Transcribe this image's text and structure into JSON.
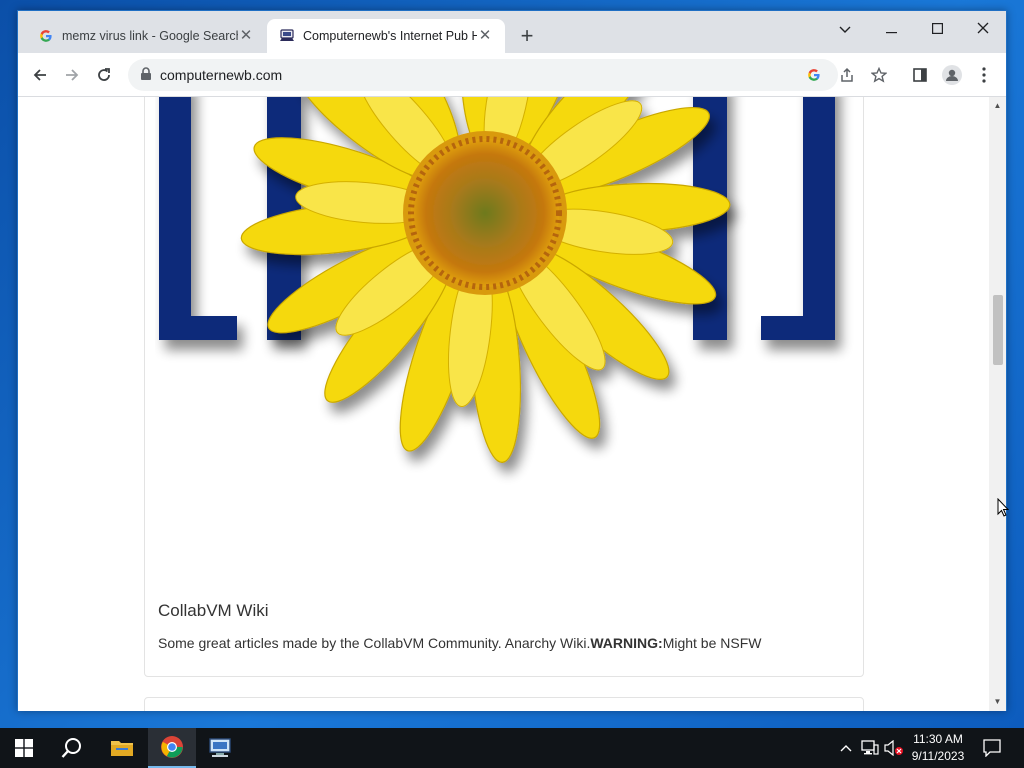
{
  "browser": {
    "tabs": [
      {
        "title": "memz virus link - Google Search",
        "active": false,
        "icon": "google-g-icon"
      },
      {
        "title": "Computernewb's Internet Pub Hub",
        "active": true,
        "icon": "computernewb-icon"
      }
    ],
    "new_tab_label": "+",
    "url": "computernewb.com"
  },
  "page": {
    "card": {
      "image_description_icon": "sunflower-logo",
      "title": "CollabVM Wiki",
      "text_prefix": "Some great articles made by the CollabVM Community. Anarchy Wiki.",
      "warning_label": "WARNING:",
      "text_suffix": "Might be NSFW"
    }
  },
  "taskbar": {
    "items": [
      "start-icon",
      "search-icon",
      "file-explorer-icon",
      "chrome-icon",
      "network-app-icon"
    ],
    "clock_time": "11:30 AM",
    "clock_date": "9/11/2023"
  },
  "colors": {
    "accent_blue": "#0a62c9",
    "logo_navy": "#0c2a7a",
    "sunflower_yellow": "#f5d90a",
    "sunflower_center": "#b57a12"
  }
}
